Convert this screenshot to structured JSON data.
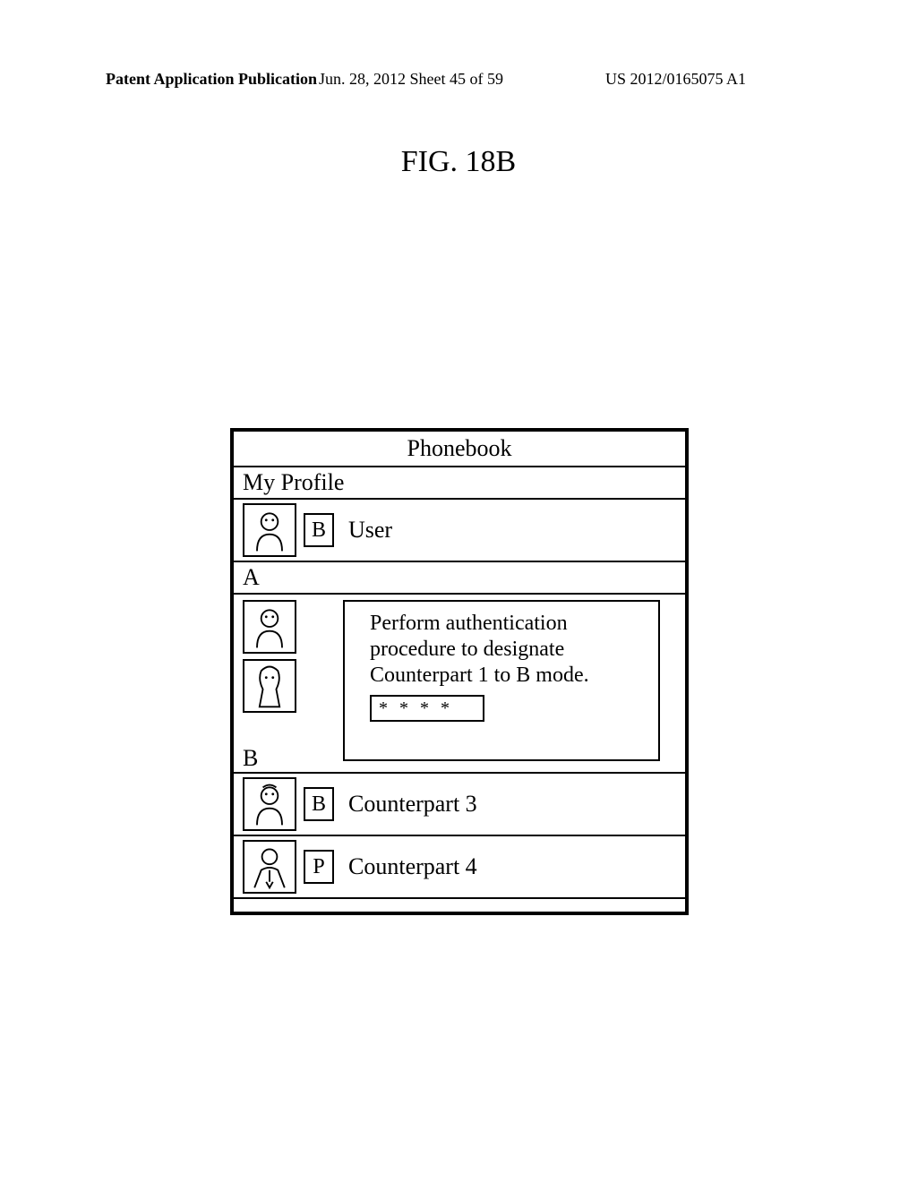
{
  "header": {
    "left": "Patent Application Publication",
    "center": "Jun. 28, 2012  Sheet 45 of 59",
    "right": "US 2012/0165075 A1"
  },
  "figure_label": "FIG. 18B",
  "phonebook": {
    "title": "Phonebook",
    "my_profile_label": "My Profile",
    "user_row": {
      "mode": "B",
      "name": "User"
    },
    "section_a": "A",
    "popup_text": "Perform authentication procedure to designate Counterpart 1 to B mode.",
    "popup_value": "* * * *",
    "section_b_badge": "B",
    "rows": [
      {
        "mode": "B",
        "name": "Counterpart 3"
      },
      {
        "mode": "P",
        "name": "Counterpart 4"
      }
    ]
  }
}
